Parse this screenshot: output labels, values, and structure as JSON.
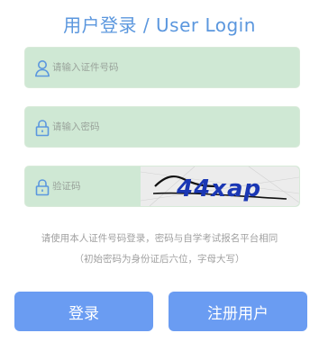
{
  "title": "用户登录 / User Login",
  "fields": {
    "id_number": {
      "placeholder": "请输入证件号码",
      "value": ""
    },
    "password": {
      "placeholder": "请输入密码",
      "value": ""
    },
    "captcha": {
      "placeholder": "验证码",
      "value": "",
      "image_text": "44xap"
    }
  },
  "hints": {
    "line1": "请使用本人证件号码登录，密码与自学考试报名平台相同",
    "line2": "（初始密码为身份证后六位，字母大写）"
  },
  "buttons": {
    "login": "登录",
    "register": "注册用户"
  },
  "colors": {
    "accent": "#6a9cf2",
    "title": "#5b97de",
    "field_bg": "#cfe8d4",
    "icon": "#5b97de"
  },
  "icons": {
    "id_number": "user-icon",
    "password": "lock-icon",
    "captcha": "lock-icon"
  }
}
